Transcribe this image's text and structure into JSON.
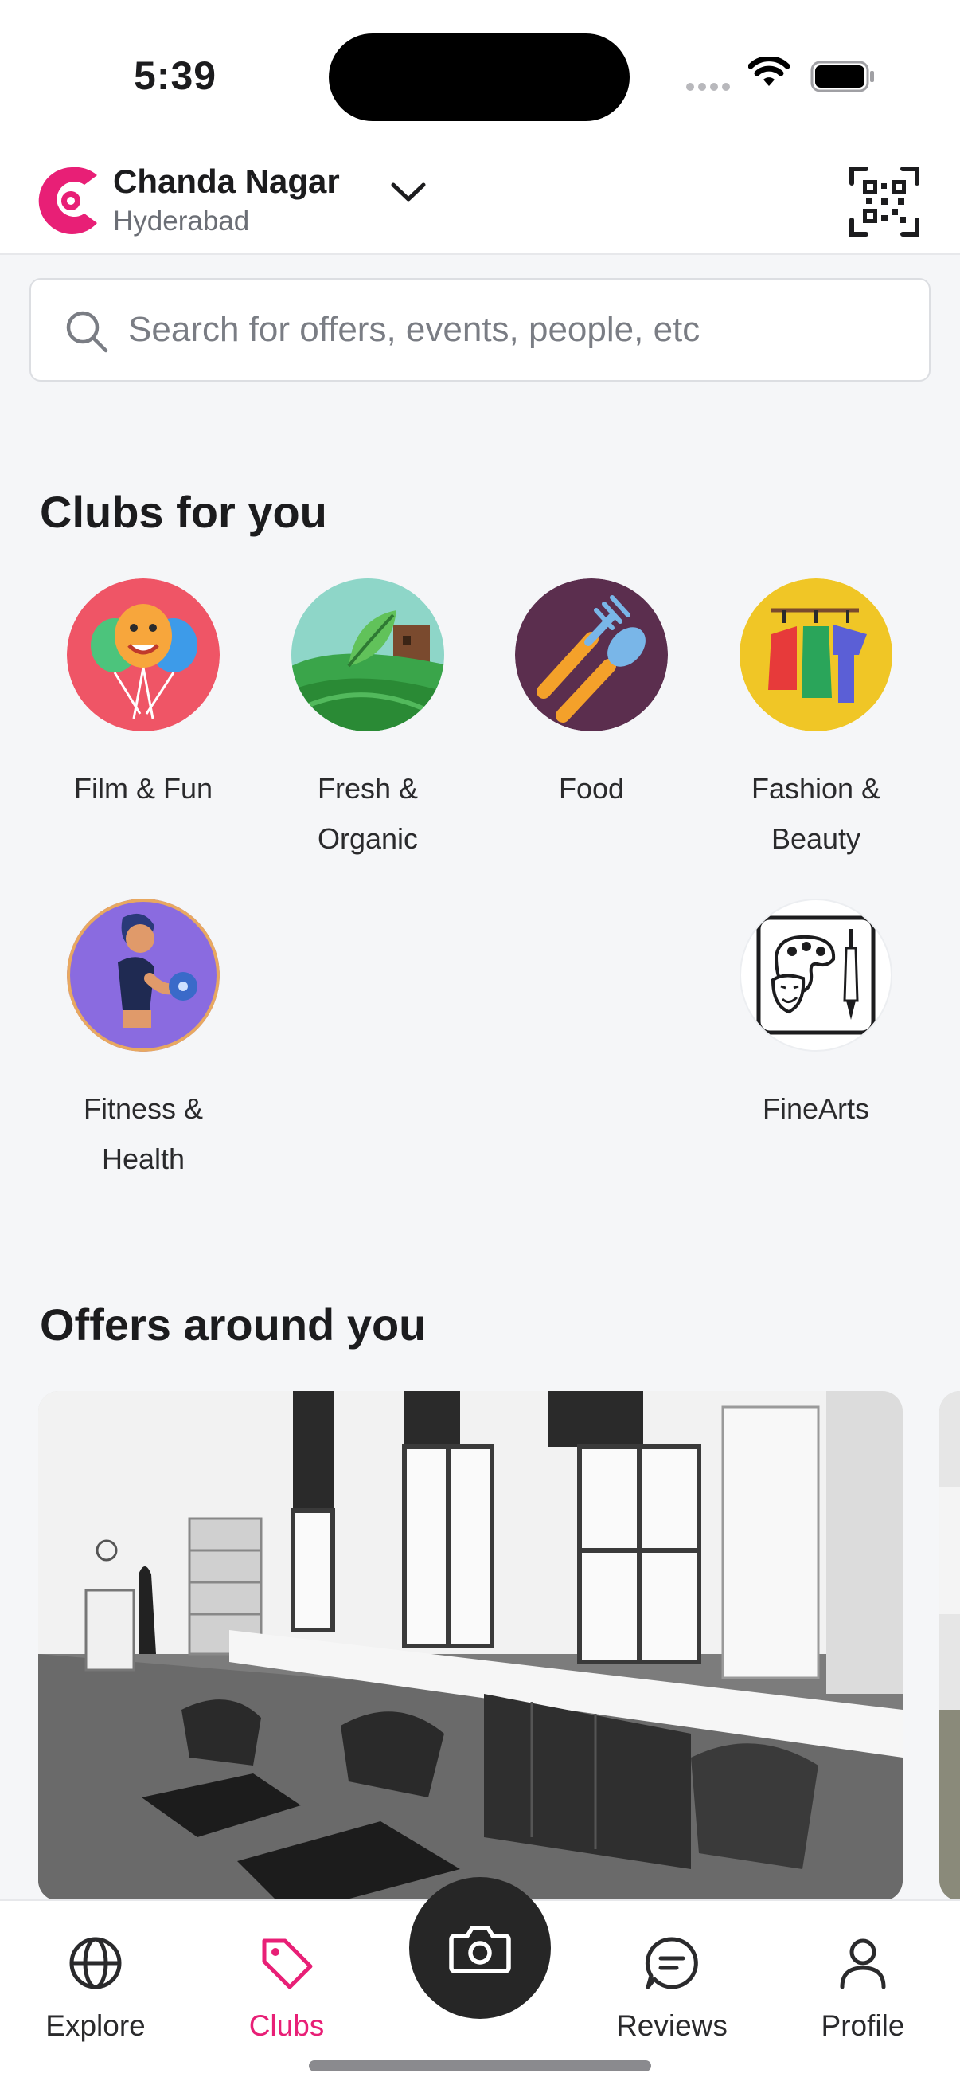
{
  "status": {
    "time": "5:39"
  },
  "header": {
    "location": "Chanda Nagar",
    "city": "Hyderabad"
  },
  "search": {
    "placeholder": "Search for offers, events, people, etc"
  },
  "clubs": {
    "title": "Clubs for you",
    "items": [
      {
        "label": "Film & Fun",
        "icon": "balloons-icon"
      },
      {
        "label": "Fresh & Organic",
        "icon": "farm-icon"
      },
      {
        "label": "Food",
        "icon": "fork-spoon-icon"
      },
      {
        "label": "Fashion & Beauty",
        "icon": "clothes-rack-icon"
      },
      {
        "label": "Fitness & Health",
        "icon": "dumbbell-woman-icon"
      },
      {
        "label": "FineArts",
        "icon": "palette-masks-icon"
      }
    ]
  },
  "offers": {
    "title": "Offers around you"
  },
  "nav": {
    "items": [
      {
        "label": "Explore",
        "icon": "globe-icon"
      },
      {
        "label": "Clubs",
        "icon": "tag-icon",
        "active": true
      },
      {
        "label": "Reviews",
        "icon": "chat-icon"
      },
      {
        "label": "Profile",
        "icon": "person-icon"
      }
    ],
    "camera_icon": "camera-icon"
  },
  "colors": {
    "brand": "#e81f76",
    "background": "#f5f6f8",
    "text": "#1c1c1e"
  }
}
